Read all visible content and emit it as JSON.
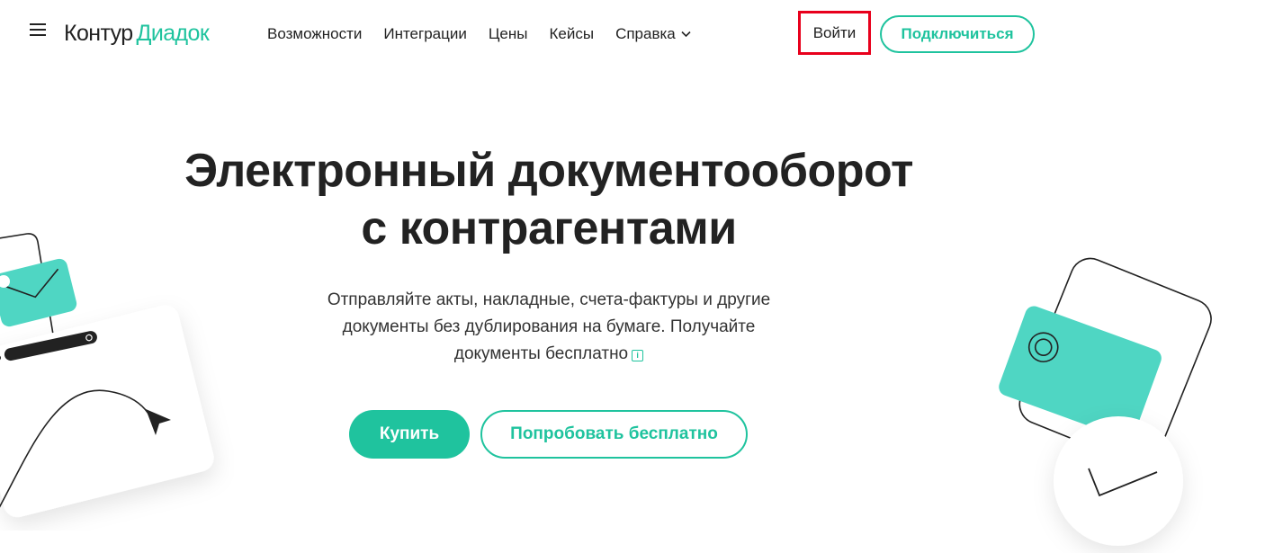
{
  "header": {
    "logo_brand": "Контур",
    "logo_product": "Диадок",
    "nav": [
      {
        "label": "Возможности"
      },
      {
        "label": "Интеграции"
      },
      {
        "label": "Цены"
      },
      {
        "label": "Кейсы"
      },
      {
        "label": "Справка"
      }
    ],
    "login_label": "Войти",
    "connect_label": "Подключиться"
  },
  "hero": {
    "title_line1": "Электронный документооборот",
    "title_line2": "с контрагентами",
    "subtitle_line1": "Отправляйте акты, накладные, счета-фактуры и другие",
    "subtitle_line2": "документы без дублирования на бумаге. Получайте",
    "subtitle_line3": "документы бесплатно",
    "buy_label": "Купить",
    "trial_label": "Попробовать бесплатно"
  },
  "colors": {
    "accent": "#1fc39e",
    "illustration_green": "#4fd6c3",
    "highlight_border": "#e8001c",
    "text": "#222222"
  },
  "icons": {
    "menu": "hamburger-menu-icon",
    "chevron": "chevron-down-icon",
    "info": "info-icon"
  }
}
